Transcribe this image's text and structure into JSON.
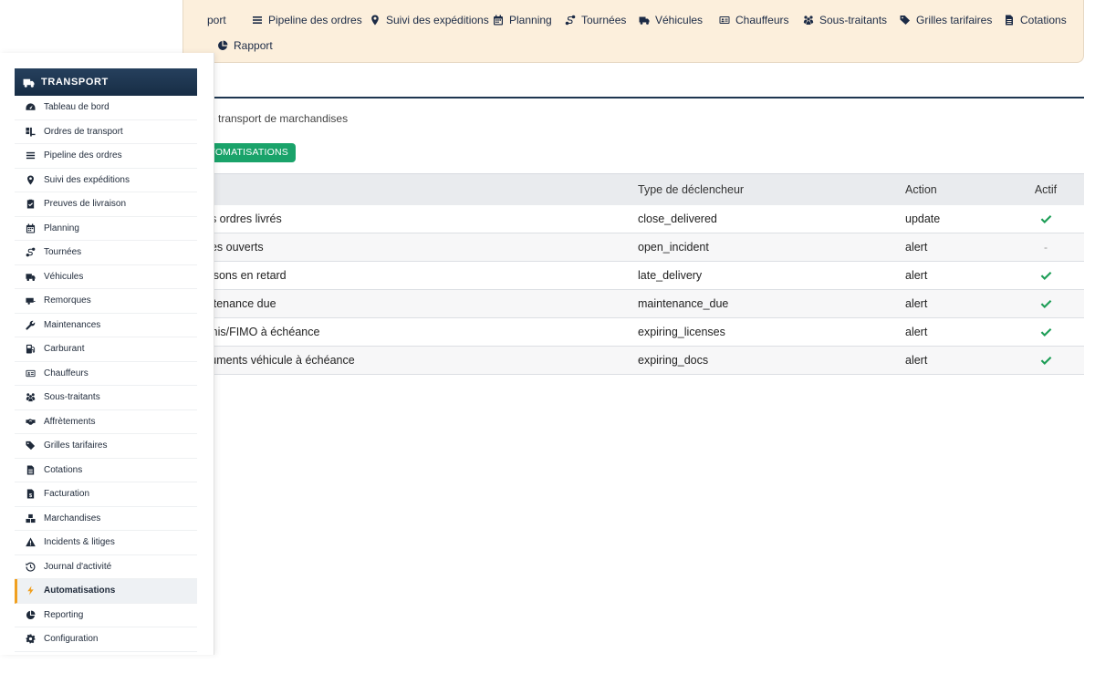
{
  "topnav": {
    "items": [
      {
        "label": "port",
        "icon": "truck-icon"
      },
      {
        "label": "Pipeline des ordres",
        "icon": "list-icon"
      },
      {
        "label": "Suivi des expéditions",
        "icon": "map-pin-icon"
      },
      {
        "label": "Planning",
        "icon": "calendar-icon"
      },
      {
        "label": "Tournées",
        "icon": "route-icon"
      },
      {
        "label": "Véhicules",
        "icon": "truck-icon"
      },
      {
        "label": "Chauffeurs",
        "icon": "id-card-icon"
      },
      {
        "label": "Sous-traitants",
        "icon": "people-icon"
      },
      {
        "label": "Grilles tarifaires",
        "icon": "tags-icon"
      },
      {
        "label": "Cotations",
        "icon": "document-icon"
      },
      {
        "label": "Rapport",
        "icon": "pie-chart-icon"
      }
    ]
  },
  "page": {
    "subtitle": "e transport de marchandises",
    "badge": "UTOMATISATIONS"
  },
  "table": {
    "headers": {
      "name": "",
      "type": "Type de déclencheur",
      "action": "Action",
      "active": "Actif"
    },
    "rows": [
      {
        "name": "es ordres livrés",
        "type": "close_delivered",
        "action": "update",
        "active": true
      },
      {
        "name": "ges ouverts",
        "type": "open_incident",
        "action": "alert",
        "active": false,
        "inactive_mark": "-"
      },
      {
        "name": "aisons en retard",
        "type": "late_delivery",
        "action": "alert",
        "active": true
      },
      {
        "name": "intenance due",
        "type": "maintenance_due",
        "action": "alert",
        "active": true
      },
      {
        "name": "rmis/FIMO à échéance",
        "type": "expiring_licenses",
        "action": "alert",
        "active": true
      },
      {
        "name": "cuments véhicule à échéance",
        "type": "expiring_docs",
        "action": "alert",
        "active": true
      }
    ]
  },
  "sidebar": {
    "title": "TRANSPORT",
    "active_color": "#f0a020",
    "items": [
      {
        "label": "Tableau de bord",
        "icon": "dashboard-icon"
      },
      {
        "label": "Ordres de transport",
        "icon": "truck-loading-icon"
      },
      {
        "label": "Pipeline des ordres",
        "icon": "list-icon"
      },
      {
        "label": "Suivi des expéditions",
        "icon": "map-pin-icon"
      },
      {
        "label": "Preuves de livraison",
        "icon": "clipboard-check-icon"
      },
      {
        "label": "Planning",
        "icon": "calendar-icon"
      },
      {
        "label": "Tournées",
        "icon": "route-icon"
      },
      {
        "label": "Véhicules",
        "icon": "truck-icon"
      },
      {
        "label": "Remorques",
        "icon": "trailer-icon"
      },
      {
        "label": "Maintenances",
        "icon": "wrench-icon"
      },
      {
        "label": "Carburant",
        "icon": "fuel-icon"
      },
      {
        "label": "Chauffeurs",
        "icon": "id-card-icon"
      },
      {
        "label": "Sous-traitants",
        "icon": "people-icon"
      },
      {
        "label": "Affrètements",
        "icon": "handshake-icon"
      },
      {
        "label": "Grilles tarifaires",
        "icon": "tags-icon"
      },
      {
        "label": "Cotations",
        "icon": "document-icon"
      },
      {
        "label": "Facturation",
        "icon": "invoice-icon"
      },
      {
        "label": "Marchandises",
        "icon": "boxes-icon"
      },
      {
        "label": "Incidents & litiges",
        "icon": "warning-icon"
      },
      {
        "label": "Journal d'activité",
        "icon": "history-icon"
      },
      {
        "label": "Automatisations",
        "icon": "bolt-icon",
        "active": true
      },
      {
        "label": "Reporting",
        "icon": "pie-chart-icon"
      },
      {
        "label": "Configuration",
        "icon": "gear-icon"
      }
    ]
  }
}
